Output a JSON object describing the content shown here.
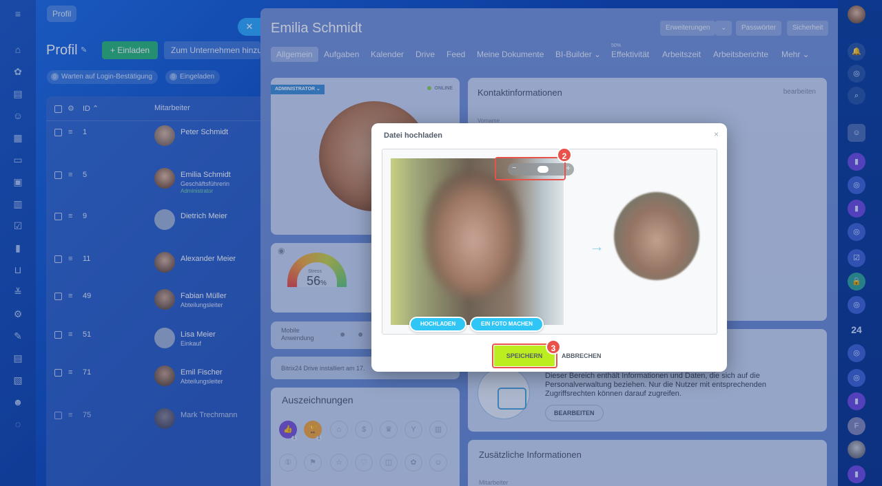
{
  "breadcrumb": "Profil",
  "list": {
    "title": "Profil",
    "invite_label": "+ Einladen",
    "to_company_label": "Zum Unternehmen hinzufügen",
    "chip_waiting_count": "0",
    "chip_waiting": "Warten auf Login-Bestätigung",
    "chip_invited_count": "0",
    "chip_invited": "Eingeladen",
    "col_id": "ID ⌃",
    "col_employee": "Mitarbeiter",
    "rows": [
      {
        "id": "1",
        "name": "Peter Schmidt",
        "title": "",
        "role": ""
      },
      {
        "id": "5",
        "name": "Emilia Schmidt",
        "title": "Geschäftsführerin",
        "role": "Administrator"
      },
      {
        "id": "9",
        "name": "Dietrich Meier",
        "title": "",
        "role": ""
      },
      {
        "id": "11",
        "name": "Alexander Meier",
        "title": "",
        "role": ""
      },
      {
        "id": "49",
        "name": "Fabian Müller",
        "title": "Abteilungsleiter",
        "role": ""
      },
      {
        "id": "51",
        "name": "Lisa Meier",
        "title": "Einkauf",
        "role": ""
      },
      {
        "id": "71",
        "name": "Emil Fischer",
        "title": "Abteilungsleiter",
        "role": ""
      },
      {
        "id": "75",
        "name": "Mark Trechmann",
        "title": "",
        "role": ""
      }
    ]
  },
  "profile": {
    "name": "Emilia Schmidt",
    "btn_extensions": "Erweiterungen",
    "btn_extensions_caret": "⌄",
    "btn_passwords": "Passwörter",
    "btn_security": "Sicherheit",
    "tabs": [
      "Allgemein",
      "Aufgaben",
      "Kalender",
      "Drive",
      "Feed",
      "Meine Dokumente",
      "BI-Builder ⌄",
      "Effektivität",
      "Arbeitszeit",
      "Arbeitsberichte",
      "Mehr ⌄"
    ],
    "efficiency_sup": "50%",
    "admin_badge": "ADMINISTRATOR ⌄",
    "online": "ONLINE",
    "stress_label": "Stress",
    "stress_value": "56",
    "stress_unit": "%",
    "mobile_label": "Mobile Anwendung",
    "drive_text": "Bitrix24 Drive installiert am 17.",
    "awards_title": "Auszeichnungen",
    "award_count_1": "1",
    "award_count_2": "1",
    "contact_title": "Kontaktinformationen",
    "contact_edit": "bearbeiten",
    "contact_firstname_label": "Vorname",
    "hr_text": "Dieser Bereich enthält Informationen und Daten, die sich auf die Personalverwaltung beziehen. Nur die Nutzer mit entsprechenden Zugriffsrechten können darauf zugreifen.",
    "hr_edit": "BEARBEITEN",
    "extra_title": "Zusätzliche Informationen",
    "extra_sub": "Mitarbeiter"
  },
  "rightrail": {
    "counter": "24"
  },
  "modal": {
    "title": "Datei hochladen",
    "close": "×",
    "upload_label": "HOCHLADEN",
    "photo_label": "EIN FOTO MACHEN",
    "save_label": "SPEICHERN",
    "cancel_label": "ABBRECHEN",
    "zoom_minus": "−",
    "zoom_plus": "+",
    "arrow": "→",
    "step_zoom": "2",
    "step_save": "3"
  },
  "colors": {
    "accent": "#2fc6f6",
    "save": "#bbed21",
    "highlight": "#e8524a",
    "invite": "#2bb87b"
  }
}
